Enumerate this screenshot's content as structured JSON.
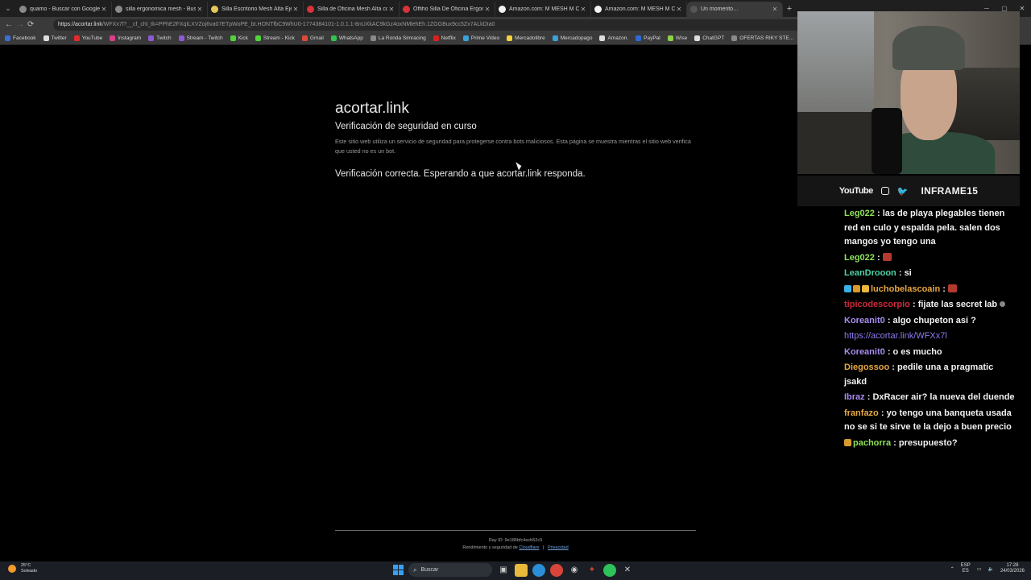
{
  "tabs": [
    {
      "title": "quamo - Buscar con Google",
      "color": "#8a8a8a",
      "active": false
    },
    {
      "title": "silla ergonomica mesh - Buscar co",
      "color": "#8a8a8a",
      "active": false
    },
    {
      "title": "Silla Escritorio Mesh Alta Ejecutiva",
      "color": "#e7c65a",
      "active": false
    },
    {
      "title": "Silla de Oficina Mesh Alta con Ap",
      "color": "#d9323a",
      "active": false
    },
    {
      "title": "Offiho Silla De Oficina Ergonómic",
      "color": "#d9323a",
      "active": false
    },
    {
      "title": "Amazon.com: M MESH M CHAIR",
      "color": "#f2f2f2",
      "active": false
    },
    {
      "title": "Amazon.com: M MESH M CHAIR",
      "color": "#f2f2f2",
      "active": false
    },
    {
      "title": "Un momento…",
      "color": "#555555",
      "active": true
    }
  ],
  "address": {
    "host": "https://acortar.link",
    "rest": "/WFXx7l?__cf_chl_tk=PPhE2FXqILXVZoj6va07ETpWoPE_bt.HONTfbC9WhU0-1774384101-1.0.1.1-8nUXkAC9kGz4oxNMlehEh.1ZGGBux9cc5Zx7ALkDIa0"
  },
  "bookmarks": [
    {
      "label": "Facebook",
      "color": "#3b6fd8"
    },
    {
      "label": "Twitter",
      "color": "#dddddd"
    },
    {
      "label": "YouTube",
      "color": "#e32b2b"
    },
    {
      "label": "Instagram",
      "color": "#d9408a"
    },
    {
      "label": "Twitch",
      "color": "#8e5ad6"
    },
    {
      "label": "Stream - Twitch",
      "color": "#8e5ad6"
    },
    {
      "label": "Kick",
      "color": "#53d43a"
    },
    {
      "label": "Stream - Kick",
      "color": "#53d43a"
    },
    {
      "label": "Gmail",
      "color": "#e04a3b"
    },
    {
      "label": "WhatsApp",
      "color": "#33c34e"
    },
    {
      "label": "La Ronda Simracing",
      "color": "#8a8a8a"
    },
    {
      "label": "Netflix",
      "color": "#d8231d"
    },
    {
      "label": "Prime Video",
      "color": "#3ba1d8"
    },
    {
      "label": "Mercadolibre",
      "color": "#f5d33a"
    },
    {
      "label": "Mercadopago",
      "color": "#3ba1d8"
    },
    {
      "label": "Amazon.",
      "color": "#dddddd"
    },
    {
      "label": "PayPal",
      "color": "#2e6bd8"
    },
    {
      "label": "Wise",
      "color": "#8cd24a"
    },
    {
      "label": "ChatGPT",
      "color": "#dddddd"
    },
    {
      "label": "OFERTAS RIKY STE...",
      "color": "#8a8a8a"
    }
  ],
  "page": {
    "site": "acortar.link",
    "heading": "Verificación de seguridad en curso",
    "description": "Este sitio web utiliza un servicio de seguridad para protegerse contra bots maliciosos. Esta página se muestra mientras el sitio web verifica que usted no es un bot.",
    "status": "Verificación correcta. Esperando a que acortar.link responda.",
    "ray_id": "Ray ID: 9e186bfc4ecb52c9",
    "perf_prefix": "Rendimiento y seguridad de",
    "perf_link": "Cloudflare",
    "separator": "|",
    "privacy_link": "Privacidad"
  },
  "socials": {
    "youtube": "YouTube",
    "handle": "INFRAME15"
  },
  "chat": [
    {
      "user": "Leg022",
      "color": "#8fe35a",
      "text": ": las de playa plegables tienen red en culo y espalda pela. salen dos mangos yo tengo una"
    },
    {
      "user": "Leg022",
      "color": "#8fe35a",
      "text": ":",
      "emote": true
    },
    {
      "user": "LeanDrooon",
      "color": "#4fd1a8",
      "text": ": si"
    },
    {
      "user": "luchobelascoain",
      "color": "#e8a842",
      "text": ":",
      "emote": true,
      "badges": [
        "#3ab0e8",
        "#d89a2e",
        "#e8b83a"
      ]
    },
    {
      "user": "tipicodescorpio",
      "color": "#cc2b3b",
      "text": ": fijate las secret lab",
      "smiley": true
    },
    {
      "user": "Koreanit0",
      "color": "#a98cf0",
      "text": ": algo chupeton asi ?"
    },
    {
      "user": "",
      "color": "#8b7cf0",
      "link": "https://acortar.link/WFXx7l"
    },
    {
      "user": "Koreanit0",
      "color": "#a98cf0",
      "text": ": o es mucho"
    },
    {
      "user": "Diegossoo",
      "color": "#e8a842",
      "text": ": pedile una a pragmatic jsakd"
    },
    {
      "user": "Ibraz",
      "color": "#a98cf0",
      "text": ": DxRacer air? la nueva del duende"
    },
    {
      "user": "franfazo",
      "color": "#e8a842",
      "text": ": yo tengo una banqueta usada no se si te sirve te la dejo a buen precio"
    },
    {
      "user": "pachorra",
      "color": "#8fe35a",
      "text": ": presupuesto?",
      "badges": [
        "#d89a2e"
      ]
    }
  ],
  "taskbar": {
    "temp": "25°C",
    "weather": "Soleado",
    "search_placeholder": "Buscar",
    "lang1": "ESP",
    "lang2": "ES",
    "time": "17:28",
    "date": "24/03/2026"
  }
}
